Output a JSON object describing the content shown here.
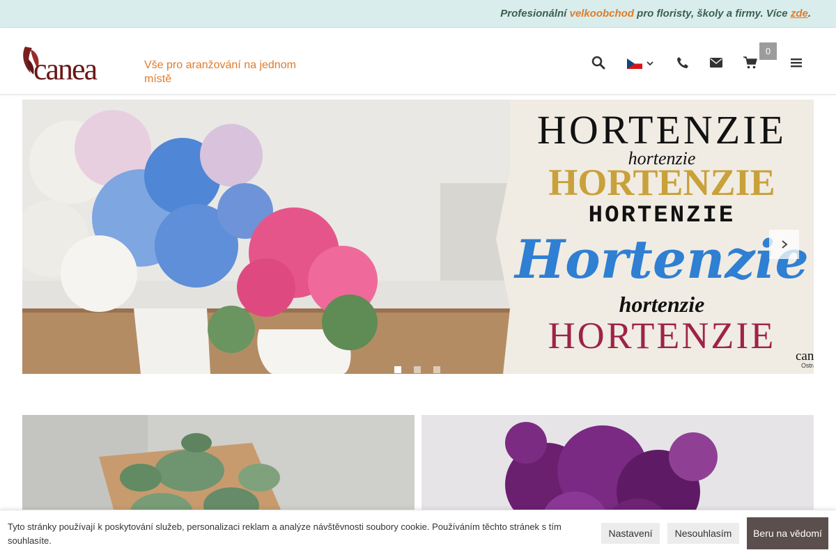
{
  "topbar": {
    "part1": "Profesionální ",
    "highlight": "velkoobchod",
    "part2": " pro floristy, školy a firmy. Více ",
    "link": "zde",
    "part3": "."
  },
  "header": {
    "logo_text": "canea",
    "tagline": "Vše pro aranžování na jednom místě",
    "cart_count": "0",
    "icons": [
      "search-icon",
      "flag-cz-icon",
      "chevron-down-icon",
      "phone-icon",
      "mail-icon",
      "cart-icon",
      "menu-icon"
    ]
  },
  "hero": {
    "slides_total": 3,
    "active_slide": 1,
    "lines": [
      "HORTENZIE",
      "hortenzie",
      "HORTENZIE",
      "HORTENZIE",
      "Hortenzie",
      "hortenzie",
      "HORTENZIE"
    ],
    "brand": "canea",
    "brand_sub": "Ostrava"
  },
  "cookie": {
    "text": "Tyto stránky používají k poskytování služeb, personalizaci reklam a analýze návštěvnosti soubory cookie. Používáním těchto stránek s tím souhlasíte.",
    "settings_label": "Nastavení",
    "decline_label": "Nesouhlasím",
    "accept_label": "Beru na vědomí"
  },
  "colors": {
    "accent": "#e07b28",
    "topbar_bg": "#d9eeec",
    "topbar_text": "#3c5f52",
    "brand": "#7a1f1f",
    "accept_bg": "#5a4f4c"
  }
}
